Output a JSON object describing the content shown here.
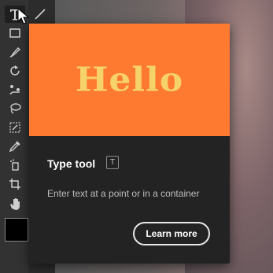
{
  "tooltip": {
    "hero_text": "Hello",
    "title": "Type tool",
    "shortcut": "T",
    "description": "Enter text at a point or in a container",
    "learn_more_label": "Learn more"
  },
  "colors": {
    "hero_background": "#ff7a31",
    "hero_text": "#f5d26a",
    "card_background": "#232323"
  },
  "toolbar": {
    "tools": [
      "type-tool-icon",
      "line-tool-icon",
      "rectangle-tool-icon",
      "paintbrush-tool-icon",
      "rotate-tool-icon",
      "puppet-warp-tool-icon",
      "lasso-tool-icon",
      "free-transform-tool-icon",
      "eyedropper-tool-icon",
      "symbol-sprayer-tool-icon",
      "artboard-tool-icon",
      "hand-tool-icon"
    ],
    "selected_tool": "type-tool-icon"
  }
}
